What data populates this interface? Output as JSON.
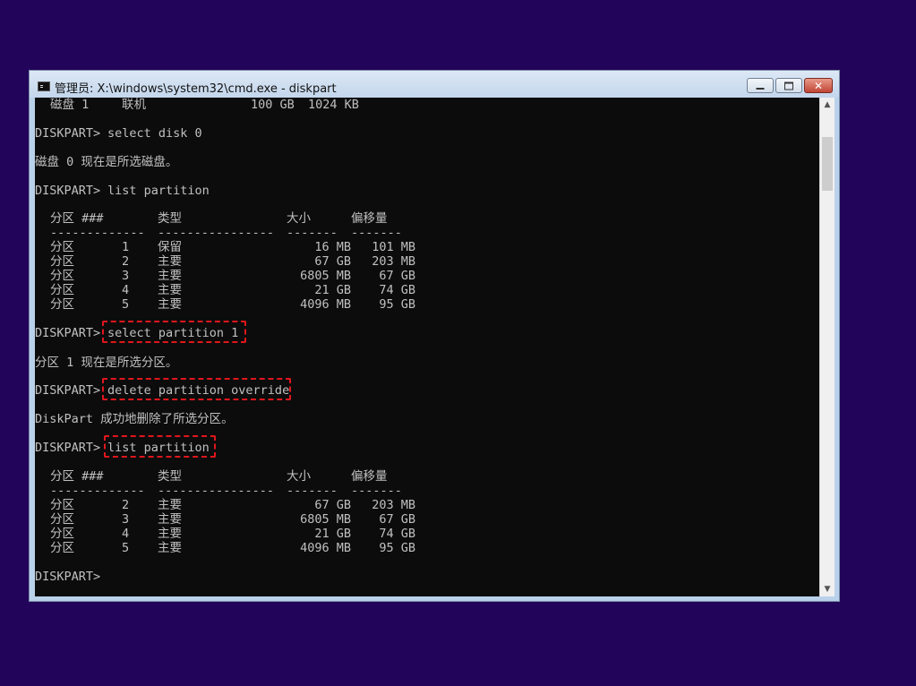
{
  "window": {
    "title": "管理员: X:\\windows\\system32\\cmd.exe - diskpart",
    "icon": "cmd-icon",
    "buttons": {
      "minimize": "",
      "maximize": "",
      "close": "✕"
    }
  },
  "console": {
    "top_row": {
      "name": "磁盘 1",
      "status": "联机",
      "size": "100 GB",
      "free": "1024 KB"
    },
    "cmd1": {
      "prompt": "DISKPART>",
      "command": "select disk 0"
    },
    "msg1": "磁盘 0 现在是所选磁盘。",
    "cmd2": {
      "prompt": "DISKPART>",
      "command": "list partition"
    },
    "table1": {
      "headers": {
        "partition": "分区 ###",
        "type": "类型",
        "size": "大小",
        "offset": "偏移量"
      },
      "dashes": {
        "partition": "-------------",
        "type": "----------------",
        "size": "-------",
        "offset": "-------"
      },
      "rows": [
        {
          "label": "分区",
          "num": "1",
          "type": "保留",
          "size": "16 MB",
          "offset": "101 MB"
        },
        {
          "label": "分区",
          "num": "2",
          "type": "主要",
          "size": "67 GB",
          "offset": "203 MB"
        },
        {
          "label": "分区",
          "num": "3",
          "type": "主要",
          "size": "6805 MB",
          "offset": "67 GB"
        },
        {
          "label": "分区",
          "num": "4",
          "type": "主要",
          "size": "21 GB",
          "offset": "74 GB"
        },
        {
          "label": "分区",
          "num": "5",
          "type": "主要",
          "size": "4096 MB",
          "offset": "95 GB"
        }
      ]
    },
    "cmd3": {
      "prompt": "DISKPART>",
      "command": "select partition 1"
    },
    "msg3": "分区 1 现在是所选分区。",
    "cmd4": {
      "prompt": "DISKPART>",
      "command": "delete partition override"
    },
    "msg4": "DiskPart 成功地删除了所选分区。",
    "cmd5": {
      "prompt": "DISKPART>",
      "command": "list partition"
    },
    "table2": {
      "headers": {
        "partition": "分区 ###",
        "type": "类型",
        "size": "大小",
        "offset": "偏移量"
      },
      "dashes": {
        "partition": "-------------",
        "type": "----------------",
        "size": "-------",
        "offset": "-------"
      },
      "rows": [
        {
          "label": "分区",
          "num": "2",
          "type": "主要",
          "size": "67 GB",
          "offset": "203 MB"
        },
        {
          "label": "分区",
          "num": "3",
          "type": "主要",
          "size": "6805 MB",
          "offset": "67 GB"
        },
        {
          "label": "分区",
          "num": "4",
          "type": "主要",
          "size": "21 GB",
          "offset": "74 GB"
        },
        {
          "label": "分区",
          "num": "5",
          "type": "主要",
          "size": "4096 MB",
          "offset": "95 GB"
        }
      ]
    },
    "final_prompt": "DISKPART>"
  },
  "colors": {
    "desktop": "#22045a",
    "console_bg": "#0c0c0c",
    "console_text": "#c0c0c0",
    "highlight": "#e0161c"
  }
}
